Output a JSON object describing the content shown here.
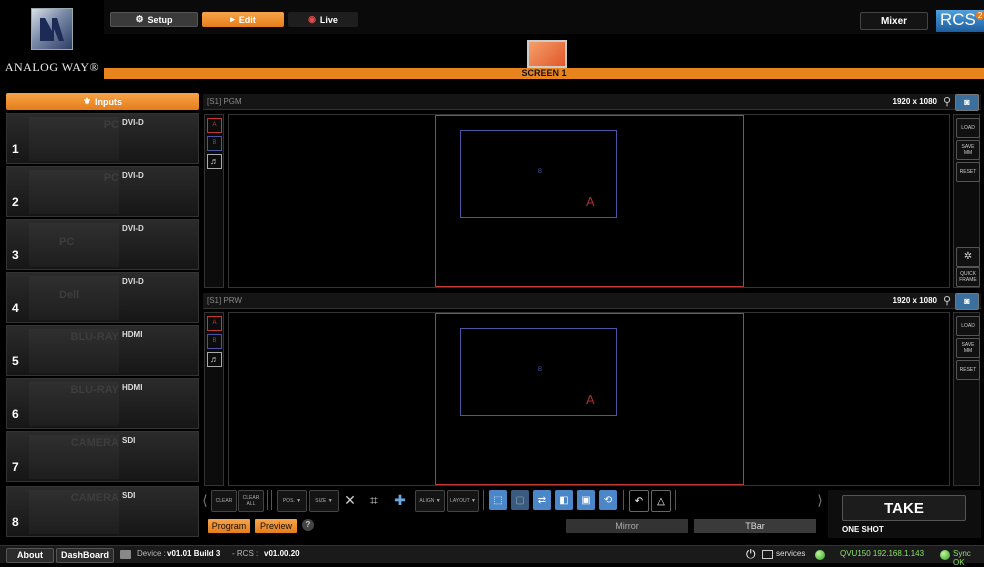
{
  "top": {
    "brand": "ANALOG WAY®",
    "tabs": [
      {
        "label": "Setup",
        "icon": "gear-icon"
      },
      {
        "label": "Edit",
        "icon": "play-icon"
      },
      {
        "label": "Live",
        "icon": "record-icon"
      }
    ],
    "mixer_label": "Mixer",
    "rcs_label": "RCS",
    "rcs_version_badge": "2"
  },
  "screen": {
    "label": "SCREEN 1"
  },
  "inputs": {
    "header": "Inputs",
    "items": [
      {
        "number": "1",
        "type": "DVI-D",
        "ghost": "PC"
      },
      {
        "number": "2",
        "type": "DVI-D",
        "ghost": "PC"
      },
      {
        "number": "3",
        "type": "DVI-D",
        "ghost": "PC"
      },
      {
        "number": "4",
        "type": "DVI-D",
        "ghost": "Dell"
      },
      {
        "number": "5",
        "type": "HDMI",
        "ghost": "BLU-RAY"
      },
      {
        "number": "6",
        "type": "HDMI",
        "ghost": "BLU-RAY"
      },
      {
        "number": "7",
        "type": "SDI",
        "ghost": "CAMERA"
      },
      {
        "number": "8",
        "type": "SDI",
        "ghost": "CAMERA"
      }
    ]
  },
  "pgm": {
    "label": "[S1] PGM",
    "resolution": "1920 x 1080"
  },
  "prw": {
    "label": "[S1] PRW",
    "resolution": "1920 x 1080"
  },
  "layers": {
    "a": "A",
    "b": "B"
  },
  "side_buttons": {
    "load": "LOAD",
    "save": "SAVE MM",
    "reset": "RESET",
    "quick": "QUICK FRAME"
  },
  "toolbar": {
    "clear": "CLEAR",
    "clear_all": "CLEAR ALL",
    "pos": "POS. ▼",
    "size": "SIZE ▼",
    "align": "ALIGN ▼",
    "layout": "LAYOUT ▼"
  },
  "bottom": {
    "program": "Program",
    "preview": "Preview",
    "help": "?",
    "mirror": "Mirror",
    "tbar": "TBar",
    "take": "TAKE",
    "one_shot": "ONE SHOT"
  },
  "status": {
    "about": "About",
    "dashboard": "DashBoard",
    "device_prefix": "Device :",
    "device_version": "v01.01 Build 3",
    "rcs_prefix": "- RCS :",
    "rcs_version": "v01.00.20",
    "services": "services",
    "device_ip": "QVU150  192.168.1.143",
    "sync": "Sync OK"
  }
}
